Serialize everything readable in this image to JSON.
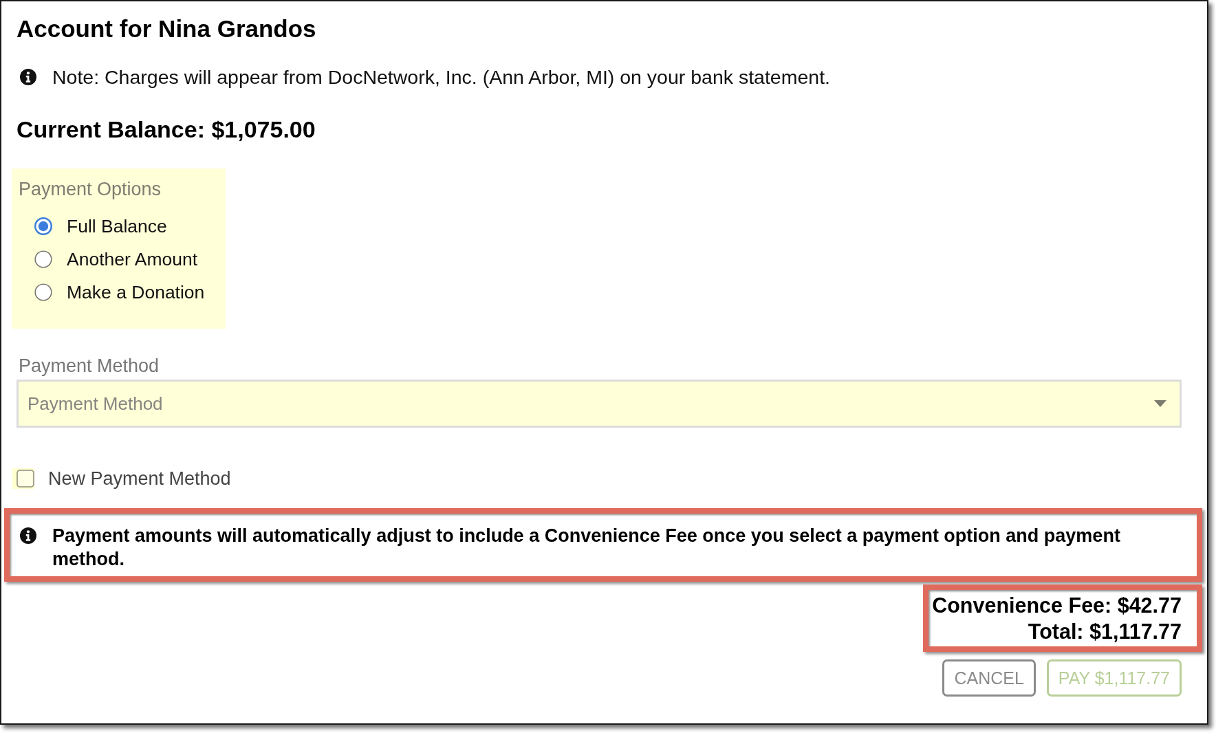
{
  "dialog": {
    "title": "Account for Nina Grandos"
  },
  "note": {
    "text": "Note: Charges will appear from DocNetwork, Inc. (Ann Arbor, MI) on your bank statement."
  },
  "current_balance": "Current Balance: $1,075.00",
  "payment_options": {
    "label": "Payment Options",
    "options": [
      {
        "label": "Full Balance",
        "selected": true
      },
      {
        "label": "Another Amount",
        "selected": false
      },
      {
        "label": "Make a Donation",
        "selected": false
      }
    ]
  },
  "payment_method": {
    "label": "Payment Method",
    "placeholder": "Payment Method"
  },
  "new_payment_method": {
    "label": "New Payment Method",
    "checked": false
  },
  "fee_notice": {
    "text": "Payment amounts will automatically adjust to include a Convenience Fee once you select a payment option and payment method.",
    "highlighted": true
  },
  "summary": {
    "convenience_fee": "Convenience Fee: $42.77",
    "total": "Total: $1,117.77",
    "highlighted": true
  },
  "buttons": [
    {
      "label": "CANCEL",
      "kind": "secondary",
      "disabled": false
    },
    {
      "label": "PAY $1,117.77",
      "kind": "primary",
      "disabled": true
    }
  ]
}
